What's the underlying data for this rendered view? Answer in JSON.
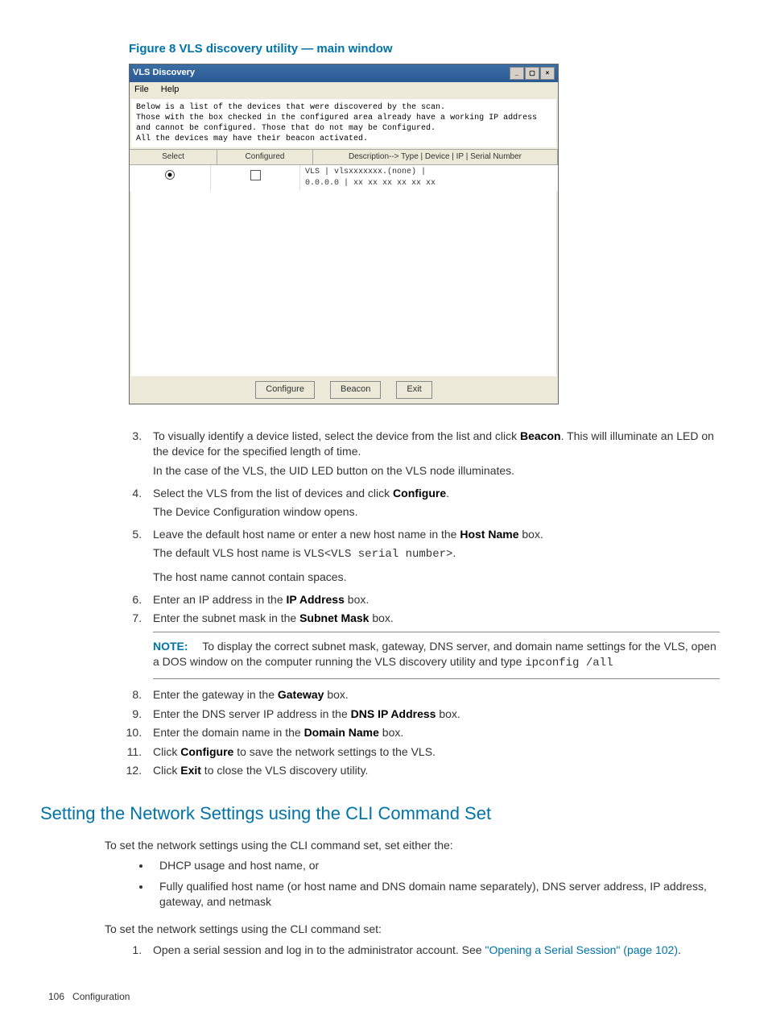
{
  "figure": {
    "caption": "Figure 8 VLS discovery utility — main window",
    "window": {
      "title": "VLS Discovery",
      "menus": [
        "File",
        "Help"
      ],
      "intro_lines": [
        "Below is a list of the devices that were discovered by the scan.",
        "Those with the box checked in the configured area already have a working IP address",
        "and cannot be configured. Those that do not may be Configured.",
        "All the devices may have their beacon activated."
      ],
      "columns": {
        "c1": "Select",
        "c2": "Configured",
        "c3": "Description--> Type | Device | IP | Serial Number"
      },
      "row": {
        "desc_line1": "VLS  | vlsxxxxxxx.(none) |",
        "desc_line2": "        0.0.0.0   | xx xx xx xx xx xx"
      },
      "buttons": {
        "configure": "Configure",
        "beacon": "Beacon",
        "exit": "Exit"
      }
    }
  },
  "steps": {
    "s3a": "To visually identify a device listed, select the device from the list and click ",
    "s3b": ". This will illuminate an LED on the device for the specified length of time.",
    "s3c": "In the case of the VLS, the UID LED button on the VLS node illuminates.",
    "s4a": "Select the VLS from the list of devices and click ",
    "s4b": ".",
    "s4c": "The Device Configuration window opens.",
    "s5a": "Leave the default host name or enter a new host name in the ",
    "s5b": " box.",
    "s5c_pre": "The default VLS host name is ",
    "s5c_mono": "VLS<VLS serial number>",
    "s5c_post": ".",
    "s5d": "The host name cannot contain spaces.",
    "s6a": "Enter an IP address in the ",
    "s6b": " box.",
    "s7a": "Enter the subnet mask in the ",
    "s7b": " box.",
    "note_label": "NOTE:",
    "note_text": "To display the correct subnet mask, gateway, DNS server, and domain name settings for the VLS, open a DOS window on the computer running the VLS discovery utility and type ",
    "note_cmd": "ipconfig /all",
    "s8a": "Enter the gateway in the ",
    "s8b": " box.",
    "s9a": "Enter the DNS server IP address in the ",
    "s9b": " box.",
    "s10a": "Enter the domain name in the ",
    "s10b": " box.",
    "s11a": "Click ",
    "s11b": " to save the network settings to the VLS.",
    "s12a": "Click ",
    "s12b": " to close the VLS discovery utility."
  },
  "bold": {
    "beacon": "Beacon",
    "configure": "Configure",
    "hostname": "Host Name",
    "ipaddress": "IP Address",
    "subnet": "Subnet Mask",
    "gateway": "Gateway",
    "dnsip": "DNS IP Address",
    "domain": "Domain Name",
    "exit": "Exit"
  },
  "section": {
    "heading": "Setting the Network Settings using the CLI Command Set",
    "intro": "To set the network settings using the CLI command set, set either the:",
    "b1": "DHCP usage and host name, or",
    "b2": "Fully qualified host name (or host name and DNS domain name separately), DNS server address, IP address, gateway, and netmask",
    "intro2": "To set the network settings using the CLI command set:",
    "step1a": "Open a serial session and log in to the administrator account. See ",
    "step1link": "\"Opening a Serial Session\" (page 102)",
    "step1b": "."
  },
  "footer": {
    "page": "106",
    "chapter": "Configuration"
  }
}
